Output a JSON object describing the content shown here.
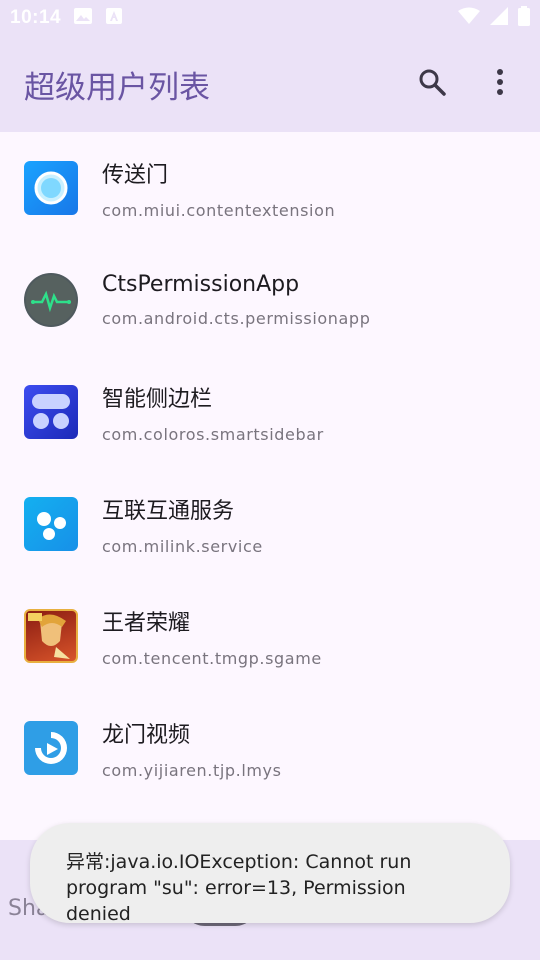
{
  "status_bar": {
    "time": "10:14",
    "left_icons": [
      "image-icon",
      "text-a-icon"
    ],
    "right_icons": [
      "wifi-icon",
      "signal-icon",
      "battery-icon"
    ]
  },
  "app_bar": {
    "title": "超级用户列表",
    "actions": [
      "search-icon",
      "more-vert-icon"
    ]
  },
  "apps": [
    {
      "name": "传送门",
      "package": "com.miui.contentextension",
      "icon": "portal-icon"
    },
    {
      "name": "CtsPermissionApp",
      "package": "com.android.cts.permissionapp",
      "icon": "heartbeat-icon"
    },
    {
      "name": "智能侧边栏",
      "package": "com.coloros.smartsidebar",
      "icon": "sidebar-icon"
    },
    {
      "name": "互联互通服务",
      "package": "com.milink.service",
      "icon": "dots-icon"
    },
    {
      "name": "王者荣耀",
      "package": "com.tencent.tmgp.sgame",
      "icon": "game-icon"
    },
    {
      "name": "龙门视频",
      "package": "com.yijiaren.tjp.lmys",
      "icon": "video-play-icon"
    }
  ],
  "bottom": {
    "shamiko_label": "Shamiko白名单",
    "switch_on": false
  },
  "toast": {
    "message": "异常:java.io.IOException: Cannot run program \"su\": error=13, Permission denied"
  },
  "colors": {
    "bar_bg": "#ebe2f7",
    "title": "#6a55a3",
    "page_bg": "#fdf7ff"
  }
}
